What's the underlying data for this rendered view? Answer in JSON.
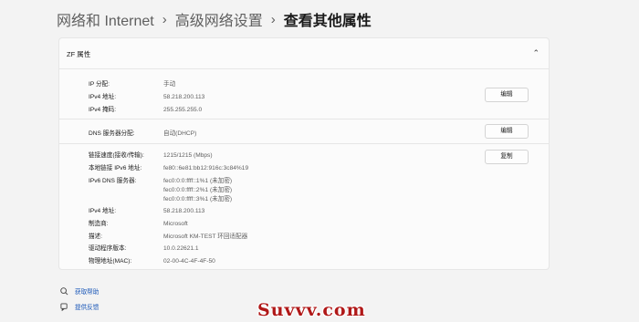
{
  "breadcrumb": {
    "item1": "网络和 Internet",
    "item2": "高级网络设置",
    "current": "查看其他属性",
    "separator": "›"
  },
  "section_header": {
    "title": "ZF 属性",
    "chevron": "⌃"
  },
  "ip_section": {
    "rows": [
      {
        "label": "IP 分配:",
        "value": "手动"
      },
      {
        "label": "IPv4 地址:",
        "value": "58.218.200.113"
      },
      {
        "label": "IPv4 掩码:",
        "value": "255.255.255.0"
      }
    ],
    "edit_label": "编辑"
  },
  "dns_section": {
    "label": "DNS 服务器分配:",
    "value": "自动(DHCP)",
    "edit_label": "编辑"
  },
  "details_section": {
    "copy_label": "复制",
    "link_speed": {
      "label": "链接速度(接收/传输):",
      "value": "1215/1215 (Mbps)"
    },
    "ipv6_local": {
      "label": "本地链接 IPv6 地址:",
      "value": "fe80::6e81:bb12:916c:3c84%19"
    },
    "ipv6_dns": {
      "label": "IPv6 DNS 服务器:",
      "values": [
        "fec0:0:0:ffff::1%1 (未加密)",
        "fec0:0:0:ffff::2%1 (未加密)",
        "fec0:0:0:ffff::3%1 (未加密)"
      ]
    },
    "ipv4_address": {
      "label": "IPv4 地址:",
      "value": "58.218.200.113"
    },
    "manufacturer": {
      "label": "制造商:",
      "value": "Microsoft"
    },
    "description": {
      "label": "描述:",
      "value": "Microsoft KM-TEST 环回适配器"
    },
    "driver_version": {
      "label": "驱动程序版本:",
      "value": "10.0.22621.1"
    },
    "mac": {
      "label": "物理地址(MAC):",
      "value": "02-00-4C-4F-4F-50"
    }
  },
  "footer_links": {
    "help": "获取帮助",
    "feedback": "提供反馈"
  },
  "watermark": "Suvvv.com"
}
